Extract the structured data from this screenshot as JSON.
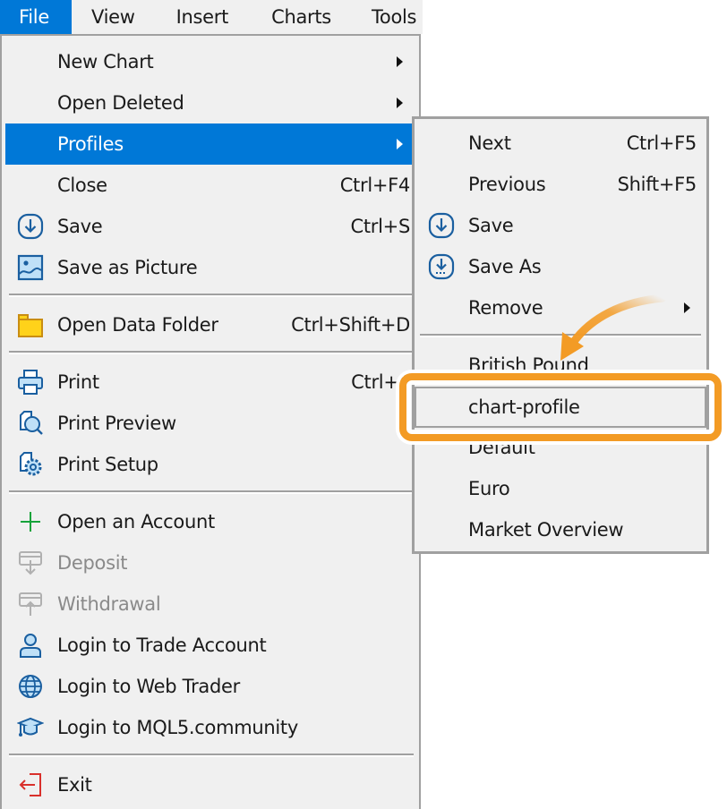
{
  "menubar": {
    "items": [
      {
        "label": "File",
        "active": true
      },
      {
        "label": "View"
      },
      {
        "label": "Insert"
      },
      {
        "label": "Charts"
      },
      {
        "label": "Tools"
      }
    ]
  },
  "file_menu": {
    "items": [
      {
        "label": "New Chart",
        "submenu": true
      },
      {
        "label": "Open Deleted",
        "submenu": true
      },
      {
        "label": "Profiles",
        "submenu": true,
        "highlighted": true
      },
      {
        "label": "Close",
        "shortcut": "Ctrl+F4"
      },
      {
        "label": "Save",
        "shortcut": "Ctrl+S",
        "icon": "save-icon"
      },
      {
        "label": "Save as Picture",
        "icon": "picture-icon"
      },
      {
        "label": "Open Data Folder",
        "shortcut": "Ctrl+Shift+D",
        "icon": "folder-icon"
      },
      {
        "label": "Print",
        "shortcut": "Ctrl+P",
        "icon": "printer-icon"
      },
      {
        "label": "Print Preview",
        "icon": "print-preview-icon"
      },
      {
        "label": "Print Setup",
        "icon": "print-setup-icon"
      },
      {
        "label": "Open an Account",
        "icon": "plus-icon"
      },
      {
        "label": "Deposit",
        "icon": "deposit-icon",
        "disabled": true
      },
      {
        "label": "Withdrawal",
        "icon": "withdrawal-icon",
        "disabled": true
      },
      {
        "label": "Login to Trade Account",
        "icon": "user-icon"
      },
      {
        "label": "Login to Web Trader",
        "icon": "globe-icon"
      },
      {
        "label": "Login to MQL5.community",
        "icon": "graduation-cap-icon"
      },
      {
        "label": "Exit",
        "icon": "exit-icon"
      }
    ]
  },
  "profiles_submenu": {
    "items": [
      {
        "label": "Next",
        "shortcut": "Ctrl+F5"
      },
      {
        "label": "Previous",
        "shortcut": "Shift+F5"
      },
      {
        "label": "Save",
        "icon": "save-icon"
      },
      {
        "label": "Save As",
        "icon": "save-as-icon"
      },
      {
        "label": "Remove",
        "submenu": true
      },
      {
        "label": "British Pound"
      },
      {
        "label": "chart-profile",
        "focused": true
      },
      {
        "label": "Default",
        "checked": true
      },
      {
        "label": "Euro"
      },
      {
        "label": "Market Overview"
      }
    ],
    "check_glyph": "✓"
  },
  "annotation": {
    "highlight_color": "#f39b25",
    "target": "chart-profile"
  },
  "colors": {
    "accent": "#0078d7",
    "menu_bg": "#f0f0f0",
    "border": "#a0a0a0",
    "icon_blue": "#1a5fa0",
    "icon_fill": "#bfe0f7",
    "folder": "#ffd21a",
    "plus_green": "#16a33a",
    "exit_red": "#d9302b"
  }
}
